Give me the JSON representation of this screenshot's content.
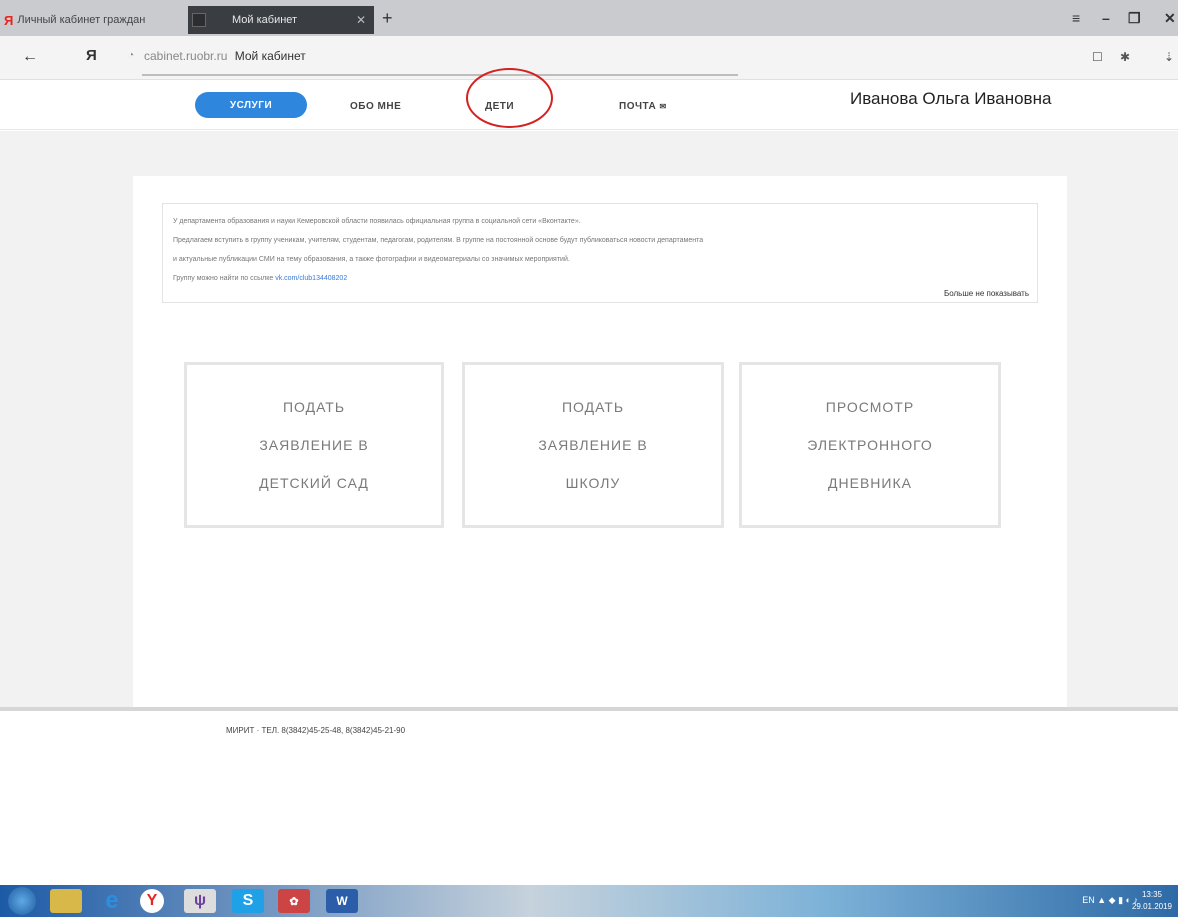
{
  "browser": {
    "tabs": [
      {
        "label": "Личный кабинет граждан"
      },
      {
        "label": "Мой кабинет"
      }
    ],
    "new_tab": "+",
    "address": {
      "domain": "cabinet.ruobr.ru",
      "page_title": "Мой кабинет"
    },
    "ya_letter": "Я"
  },
  "header": {
    "nav": {
      "services": "УСЛУГИ",
      "about": "ОБО МНЕ",
      "kids": "ДЕТИ",
      "mail": "ПОЧТА"
    },
    "username": "Иванова Ольга Ивановна"
  },
  "notice": {
    "line1": "У департамента образования и науки Кемеровской области появилась официальная группа в социальной сети «Вконтакте».",
    "line2": "Предлагаем вступить в группу ученикам, учителям, студентам, педагогам, родителям. В группе на постоянной основе будут публиковаться новости департамента",
    "line3": "и актуальные публикации СМИ на тему образования, а также фотографии и видеоматериалы со значимых мероприятий.",
    "line4_prefix": "Группу можно найти по ссылке",
    "link": "vk.com/club134408202",
    "hide_label": "Больше не показывать"
  },
  "cards": [
    {
      "l1": "ПОДАТЬ",
      "l2": "ЗАЯВЛЕНИЕ В",
      "l3": "ДЕТСКИЙ САД"
    },
    {
      "l1": "ПОДАТЬ",
      "l2": "ЗАЯВЛЕНИЕ В",
      "l3": "ШКОЛУ"
    },
    {
      "l1": "ПРОСМОТР",
      "l2": "ЭЛЕКТРОННОГО",
      "l3": "ДНЕВНИКА"
    }
  ],
  "footer": {
    "text": "МИРИТ · ТЕЛ. 8(3842)45-25-48, 8(3842)45-21-90"
  },
  "taskbar": {
    "lang": "EN",
    "time": "13:35",
    "date": "29.01.2019"
  },
  "colors": {
    "accent": "#2f86dd",
    "highlight_circle": "#d42222"
  },
  "icons": [
    "back-arrow-icon",
    "yandex-icon",
    "lock-icon",
    "bookmark-icon",
    "star-icon",
    "download-icon",
    "windows-start-icon",
    "explorer-icon",
    "ie-icon",
    "yandex-browser-icon",
    "skype-icon",
    "word-icon"
  ]
}
